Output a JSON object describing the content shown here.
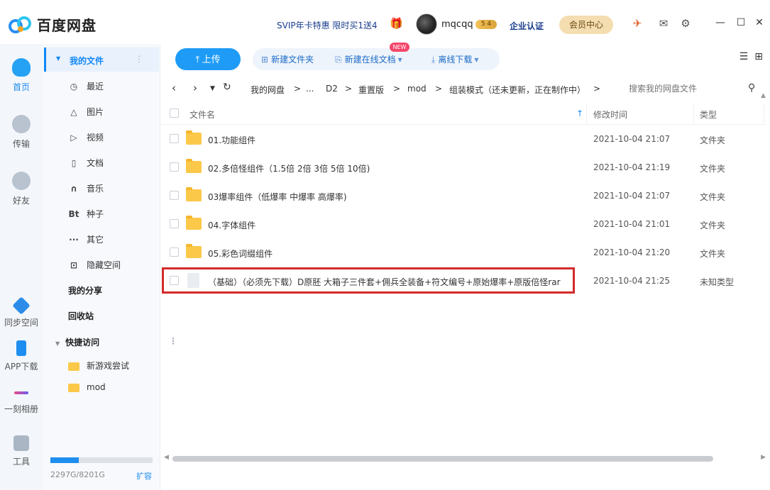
{
  "app": {
    "name": "百度网盘",
    "promo": "SVIP年卡特惠 限时买1送4",
    "username": "mqcqq",
    "vip_level": "5 4",
    "enterprise": "企业认证",
    "member_center": "会员中心"
  },
  "rail": {
    "home": "首页",
    "transfer": "传输",
    "friends": "好友",
    "sync": "同步空间",
    "app_download": "APP下载",
    "album": "一刻相册",
    "tools": "工具"
  },
  "sidebar": {
    "my_files": "我的文件",
    "items": [
      "最近",
      "图片",
      "视频",
      "文档",
      "音乐",
      "种子",
      "其它",
      "隐藏空间"
    ],
    "item_icons": [
      "clock-icon",
      "image-icon",
      "play-icon",
      "doc-icon",
      "headphone-icon",
      "bt-icon",
      "more-icon",
      "lock-icon"
    ],
    "my_share": "我的分享",
    "recycle": "回收站",
    "quick_access": "快捷访问",
    "quick_items": [
      "新游戏尝试",
      "mod"
    ],
    "storage": "2297G/8201G",
    "expand": "扩容",
    "storage_used_fraction": 0.28
  },
  "toolbar": {
    "upload": "上传",
    "new_folder": "新建文件夹",
    "new_online_doc": "新建在线文档",
    "new_badge": "NEW",
    "offline_download": "离线下载"
  },
  "breadcrumb": {
    "items": [
      "我的网盘",
      ">",
      "...",
      "D2",
      ">",
      "重置版",
      ">",
      "mod",
      ">",
      "组装模式（还未更新，正在制作中）",
      ">"
    ],
    "search_placeholder": "搜索我的网盘文件"
  },
  "table": {
    "headers": {
      "name": "文件名",
      "modified": "修改时间",
      "type": "类型"
    },
    "rows": [
      {
        "name": "01.功能组件",
        "time": "2021-10-04 21:07",
        "type": "文件夹",
        "kind": "folder"
      },
      {
        "name": "02.多倍怪组件（1.5倍 2倍 3倍 5倍 10倍)",
        "time": "2021-10-04 21:19",
        "type": "文件夹",
        "kind": "folder"
      },
      {
        "name": "03爆率组件（低爆率 中爆率 高爆率)",
        "time": "2021-10-04 21:07",
        "type": "文件夹",
        "kind": "folder"
      },
      {
        "name": "04.字体组件",
        "time": "2021-10-04 21:01",
        "type": "文件夹",
        "kind": "folder"
      },
      {
        "name": "05.彩色词缀组件",
        "time": "2021-10-04 21:20",
        "type": "文件夹",
        "kind": "folder"
      },
      {
        "name": "（基础）（必须先下载）D原胚 大箱子三件套+佣兵全装备+符文编号+原始爆率+原版倍怪rar",
        "time": "2021-10-04 21:25",
        "type": "未知类型",
        "kind": "file"
      }
    ]
  }
}
